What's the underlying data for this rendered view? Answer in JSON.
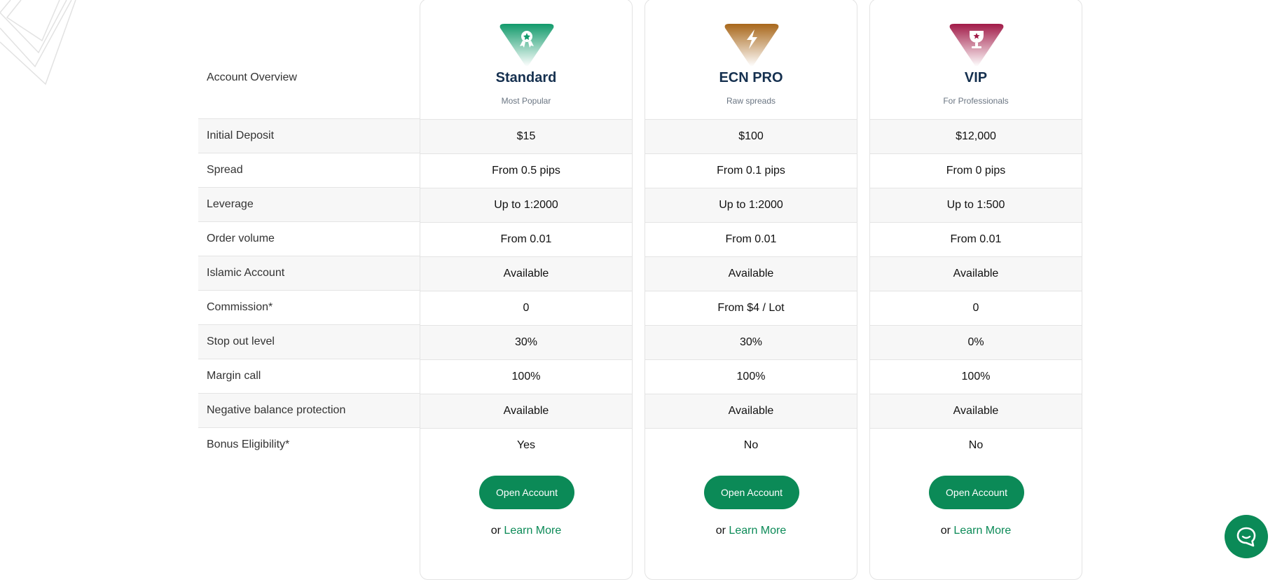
{
  "row_labels": {
    "header": "Account Overview",
    "rows": [
      "Initial Deposit",
      "Spread",
      "Leverage",
      "Order volume",
      "Islamic Account",
      "Commission*",
      "Stop out level",
      "Margin call",
      "Negative balance protection",
      "Bonus Eligibility*"
    ]
  },
  "plans": [
    {
      "name": "Standard",
      "subtitle": "Most Popular",
      "icon": "award-ribbon-icon",
      "badge_color": "#119a6b",
      "values": [
        "$15",
        "From 0.5 pips",
        "Up to 1:2000",
        "From 0.01",
        "Available",
        "0",
        "30%",
        "100%",
        "Available",
        "Yes"
      ],
      "button_label": "Open Account",
      "or_text": "or",
      "link_label": "Learn More"
    },
    {
      "name": "ECN PRO",
      "subtitle": "Raw spreads",
      "icon": "lightning-bolt-icon",
      "badge_color": "#a8671a",
      "values": [
        "$100",
        "From 0.1 pips",
        "Up to 1:2000",
        "From 0.01",
        "Available",
        "From $4 / Lot",
        "30%",
        "100%",
        "Available",
        "No"
      ],
      "button_label": "Open Account",
      "or_text": "or",
      "link_label": "Learn More"
    },
    {
      "name": "VIP",
      "subtitle": "For Professionals",
      "icon": "trophy-icon",
      "badge_color": "#a11a48",
      "values": [
        "$12,000",
        "From 0 pips",
        "Up to 1:500",
        "From 0.01",
        "Available",
        "0",
        "0%",
        "100%",
        "Available",
        "No"
      ],
      "button_label": "Open Account",
      "or_text": "or",
      "link_label": "Learn More"
    }
  ],
  "chat": {
    "icon": "chat-bubble-icon"
  },
  "colors": {
    "accent": "#0b8a57",
    "heading": "#15304f"
  }
}
